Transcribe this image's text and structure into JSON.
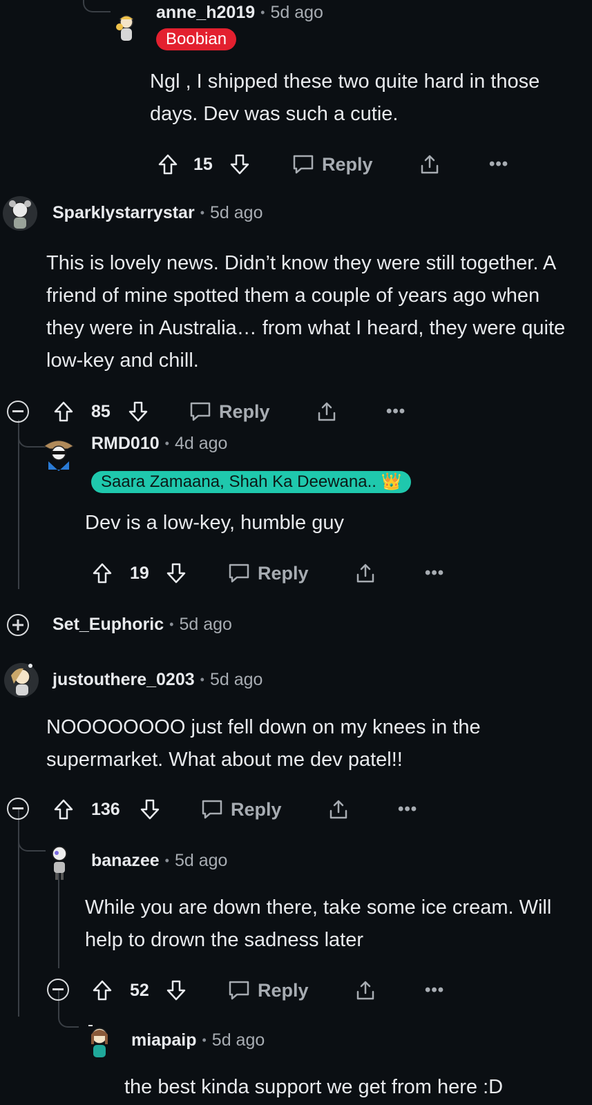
{
  "comments": [
    {
      "username": "anne_h2019",
      "time": "5d ago",
      "flair": "Boobian",
      "body": "Ngl , I shipped these two quite hard in those days. Dev was such a cutie.",
      "votes": "15",
      "reply_label": "Reply"
    },
    {
      "username": "Sparklystarrystar",
      "time": "5d ago",
      "body": "This is lovely news. Didn’t know they were still together. A friend of mine spotted them a couple of years ago when they were in Australia… from what I heard, they were quite low-key and chill.",
      "votes": "85",
      "reply_label": "Reply"
    },
    {
      "username": "RMD010",
      "time": "4d ago",
      "flair": "Saara Zamaana, Shah Ka Deewana.. 👑",
      "body": "Dev is a low-key, humble guy",
      "votes": "19",
      "reply_label": "Reply"
    },
    {
      "username": "Set_Euphoric",
      "time": "5d ago"
    },
    {
      "username": "justouthere_0203",
      "time": "5d ago",
      "body": "NOOOOOOOO just fell down on my knees in the supermarket. What about me dev patel!!",
      "votes": "136",
      "reply_label": "Reply"
    },
    {
      "username": "banazee",
      "time": "5d ago",
      "body": "While you are down there, take some ice cream. Will help to drown the sadness later",
      "votes": "52",
      "reply_label": "Reply"
    },
    {
      "username": "miapaip",
      "time": "5d ago",
      "body": "the best kinda support we get from here :D"
    }
  ],
  "separator": "•",
  "more_label": "•••",
  "colors": {
    "background": "#0b0f13",
    "flair_red": "#e3202f",
    "flair_teal": "#1fc8ad"
  },
  "icons": [
    "upvote-icon",
    "downvote-icon",
    "reply-bubble-icon",
    "share-icon",
    "more-icon",
    "collapse-icon",
    "expand-icon"
  ]
}
